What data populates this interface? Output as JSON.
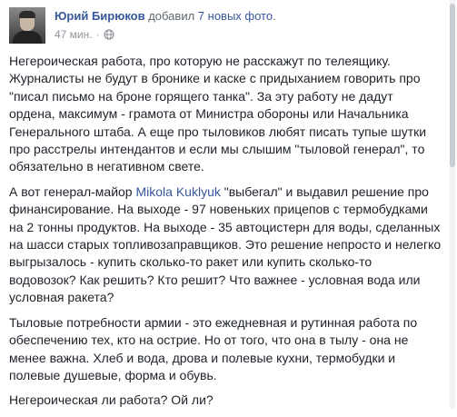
{
  "post": {
    "author": "Юрий Бирюков",
    "action_prefix": "добавил",
    "action_link": "7 новых фото",
    "action_suffix": ".",
    "time": "47 мин.",
    "time_separator": "·",
    "privacy_icon": "globe-icon"
  },
  "body": {
    "p1": "Негероическая работа, про которую не расскажут по телеящику. Журналисты не будут в бронике и каске с придыханием говорить про \"писал письмо на броне горящего танка\". За эту работу не дадут ордена, максимум - грамота от Министра обороны или Начальника Генерального штаба. А еще про тыловиков любят писать тупые шутки про расстрелы интендантов и если мы слышим \"тыловой генерал\", то обязательно в негативном свете.",
    "p2_before": "А вот генерал-майор ",
    "p2_mention": "Mikola Kuklyuk",
    "p2_after": " \"выбегал\" и выдавил решение про финансирование. На выходе - 97 новеньких прицепов с термобудками на 2 тонны продуктов. На выходе - 35 автоцистерн для воды, сделанных на шасси старых топливозаправщиков. Это решение непросто и нелегко выгрызалось - купить сколько-то ракет или купить сколько-то водовозок? Как решить? Кто решит? Что важнее - условная вода или условная ракета?",
    "p3": "Тыловые потребности армии - это ежедневная и рутинная работа по обеспечению тех, кто на острие. Но от того, что она в тылу - она не менее важна. Хлеб и вода, дрова и полевые кухни, термобудки и полевые душевые, форма и обувь.",
    "p4": "Негероическая ли работа? Ой ли?"
  },
  "colors": {
    "link": "#365899",
    "text": "#1d2129",
    "muted": "#90949c"
  }
}
